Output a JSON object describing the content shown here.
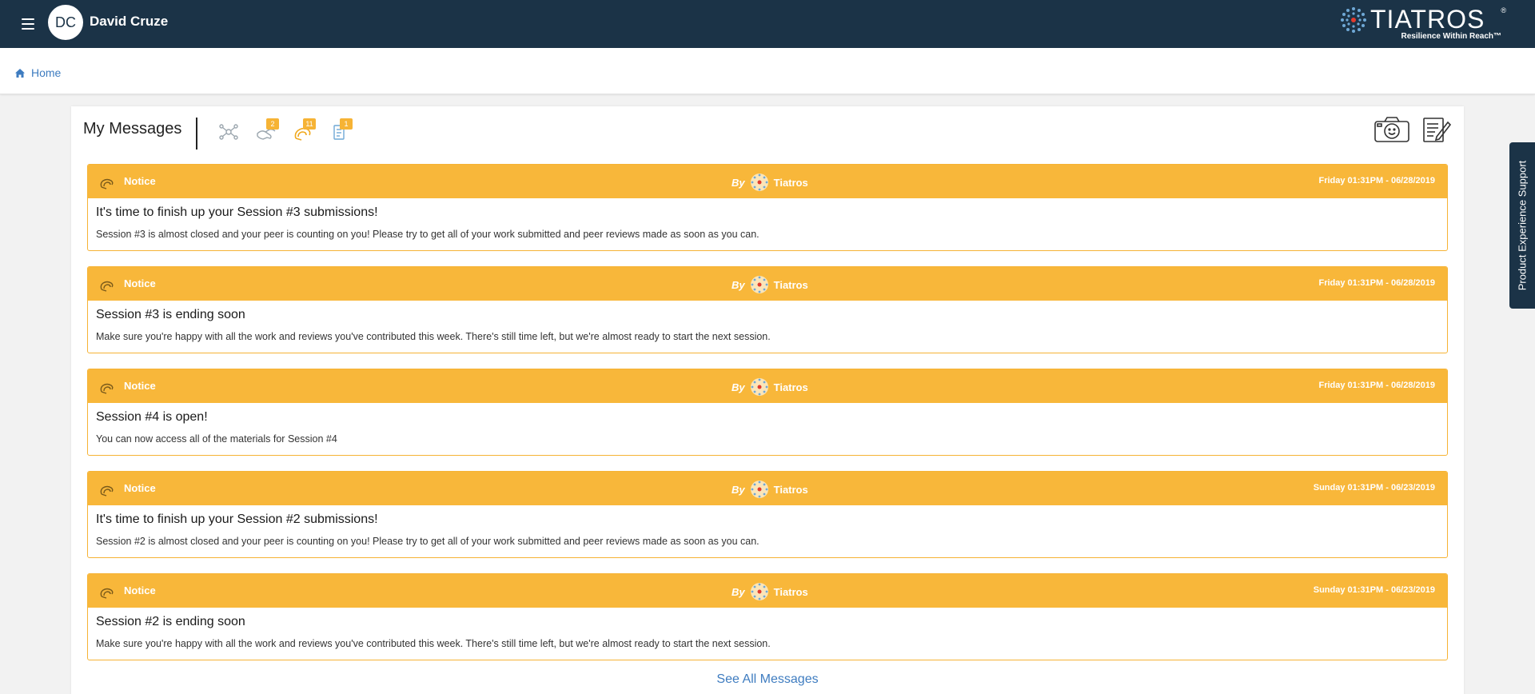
{
  "topbar": {
    "user_initials": "DC",
    "user_name": "David Cruze",
    "brand_name": "TIATROS",
    "brand_reg": "®",
    "brand_tagline": "Resilience Within Reach™"
  },
  "breadcrumb": {
    "home_label": "Home"
  },
  "messages_panel": {
    "title": "My Messages",
    "filters": [
      {
        "icon": "network-icon",
        "badge": ""
      },
      {
        "icon": "handshake-icon",
        "badge": "2"
      },
      {
        "icon": "notice-icon",
        "badge": "11"
      },
      {
        "icon": "document-icon",
        "badge": "1"
      }
    ],
    "messages": [
      {
        "type": "Notice",
        "by_label": "By",
        "sender": "Tiatros",
        "date": "Friday 01:31PM - 06/28/2019",
        "title": "It's time to finish up your Session #3 submissions!",
        "body": "Session #3 is almost closed and your peer is counting on you! Please try to get all of your work submitted and peer reviews made as soon as you can."
      },
      {
        "type": "Notice",
        "by_label": "By",
        "sender": "Tiatros",
        "date": "Friday 01:31PM - 06/28/2019",
        "title": "Session #3 is ending soon",
        "body": "Make sure you're happy with all the work and reviews you've contributed this week. There's still time left, but we're almost ready to start the next session."
      },
      {
        "type": "Notice",
        "by_label": "By",
        "sender": "Tiatros",
        "date": "Friday 01:31PM - 06/28/2019",
        "title": "Session #4 is open!",
        "body": "You can now access all of the materials for Session #4"
      },
      {
        "type": "Notice",
        "by_label": "By",
        "sender": "Tiatros",
        "date": "Sunday 01:31PM - 06/23/2019",
        "title": "It's time to finish up your Session #2 submissions!",
        "body": "Session #2 is almost closed and your peer is counting on you! Please try to get all of your work submitted and peer reviews made as soon as you can."
      },
      {
        "type": "Notice",
        "by_label": "By",
        "sender": "Tiatros",
        "date": "Sunday 01:31PM - 06/23/2019",
        "title": "Session #2 is ending soon",
        "body": "Make sure you're happy with all the work and reviews you've contributed this week. There's still time left, but we're almost ready to start the next session."
      }
    ],
    "see_all_label": "See All Messages"
  },
  "side_tab": {
    "label": "Product Experience Support"
  },
  "colors": {
    "navbar": "#1b3347",
    "accent": "#f8b73a",
    "link": "#3e7cc0"
  }
}
